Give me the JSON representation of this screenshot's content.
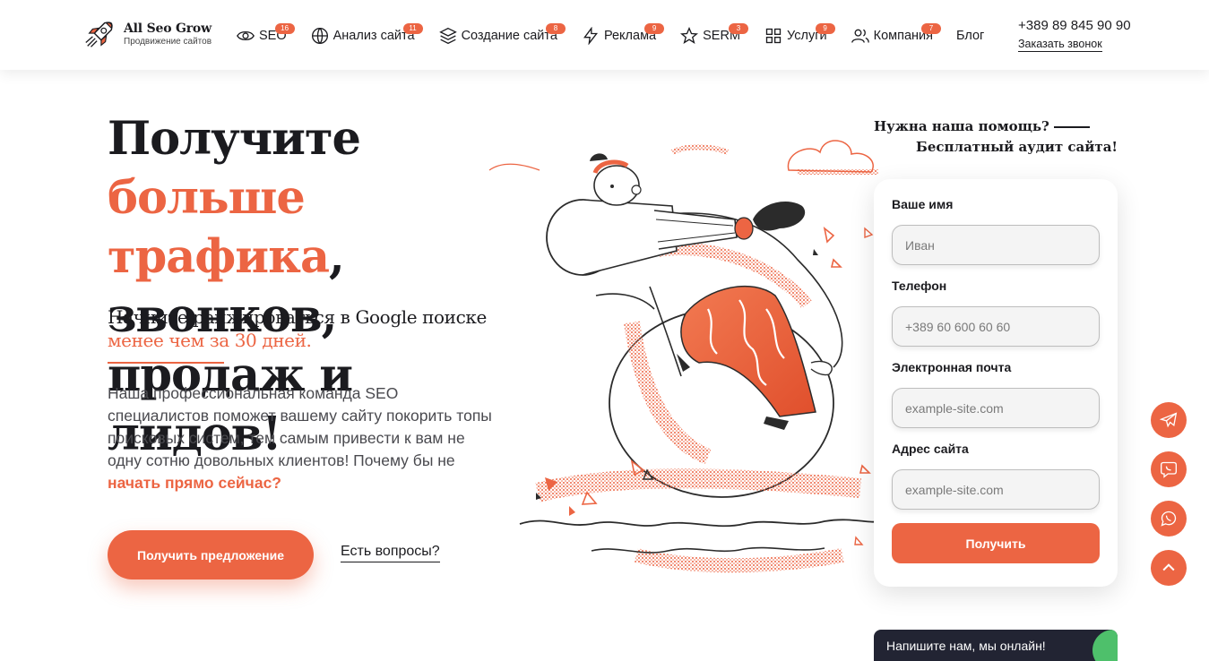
{
  "brand": {
    "name": "All Seo Grow",
    "tagline": "Продвижение сайтов"
  },
  "nav": {
    "items": [
      {
        "label": "SEO",
        "badge": "16",
        "icon": "eye-icon"
      },
      {
        "label": "Анализ сайта",
        "badge": "11",
        "icon": "globe-icon"
      },
      {
        "label": "Создание сайта",
        "badge": "8",
        "icon": "layers-icon"
      },
      {
        "label": "Реклама",
        "badge": "9",
        "icon": "lightning-icon"
      },
      {
        "label": "SERM",
        "badge": "3",
        "icon": "star-icon"
      },
      {
        "label": "Услуги",
        "badge": "9",
        "icon": "grid-icon"
      },
      {
        "label": "Компания",
        "badge": "7",
        "icon": "users-icon"
      },
      {
        "label": "Блог"
      }
    ]
  },
  "contact": {
    "phone": "+389 89 845 90 90",
    "callback": "Заказать звонок"
  },
  "hero": {
    "title_part1": "Получите ",
    "title_accent": "больше трафика",
    "title_part2": ", звонков, продаж и лидов!",
    "subtitle": "Начните ранжироваться в Google поиске",
    "subtitle_accent": "менее чем за 30 дней.",
    "description": "Наша профессиональная команда SEO специалистов поможет вашему сайту покорить топы поисковых систем, тем самым привести к вам не одну сотню довольных клиентов! Почему бы не ",
    "description_accent": "начать прямо сейчас?",
    "cta": "Получить предложение",
    "questions": "Есть вопросы?"
  },
  "form": {
    "help_line1": "Нужна наша помощь?",
    "help_line2": "Бесплатный аудит сайта!",
    "fields": [
      {
        "label": "Ваше имя",
        "placeholder": "Иван"
      },
      {
        "label": "Телефон",
        "placeholder": "+389 60 600 60 60"
      },
      {
        "label": "Электронная почта",
        "placeholder": "example-site.com"
      },
      {
        "label": "Адрес сайта",
        "placeholder": "example-site.com"
      }
    ],
    "submit": "Получить"
  },
  "side_buttons": [
    "telegram-icon",
    "viber-icon",
    "whatsapp-icon",
    "arrow-up-icon"
  ],
  "chat": {
    "text": "Напишите нам, мы онлайн!"
  },
  "colors": {
    "accent": "#ec6543",
    "text": "#1b1b1f",
    "chat_bg": "#222433",
    "online": "#4ec06b"
  }
}
